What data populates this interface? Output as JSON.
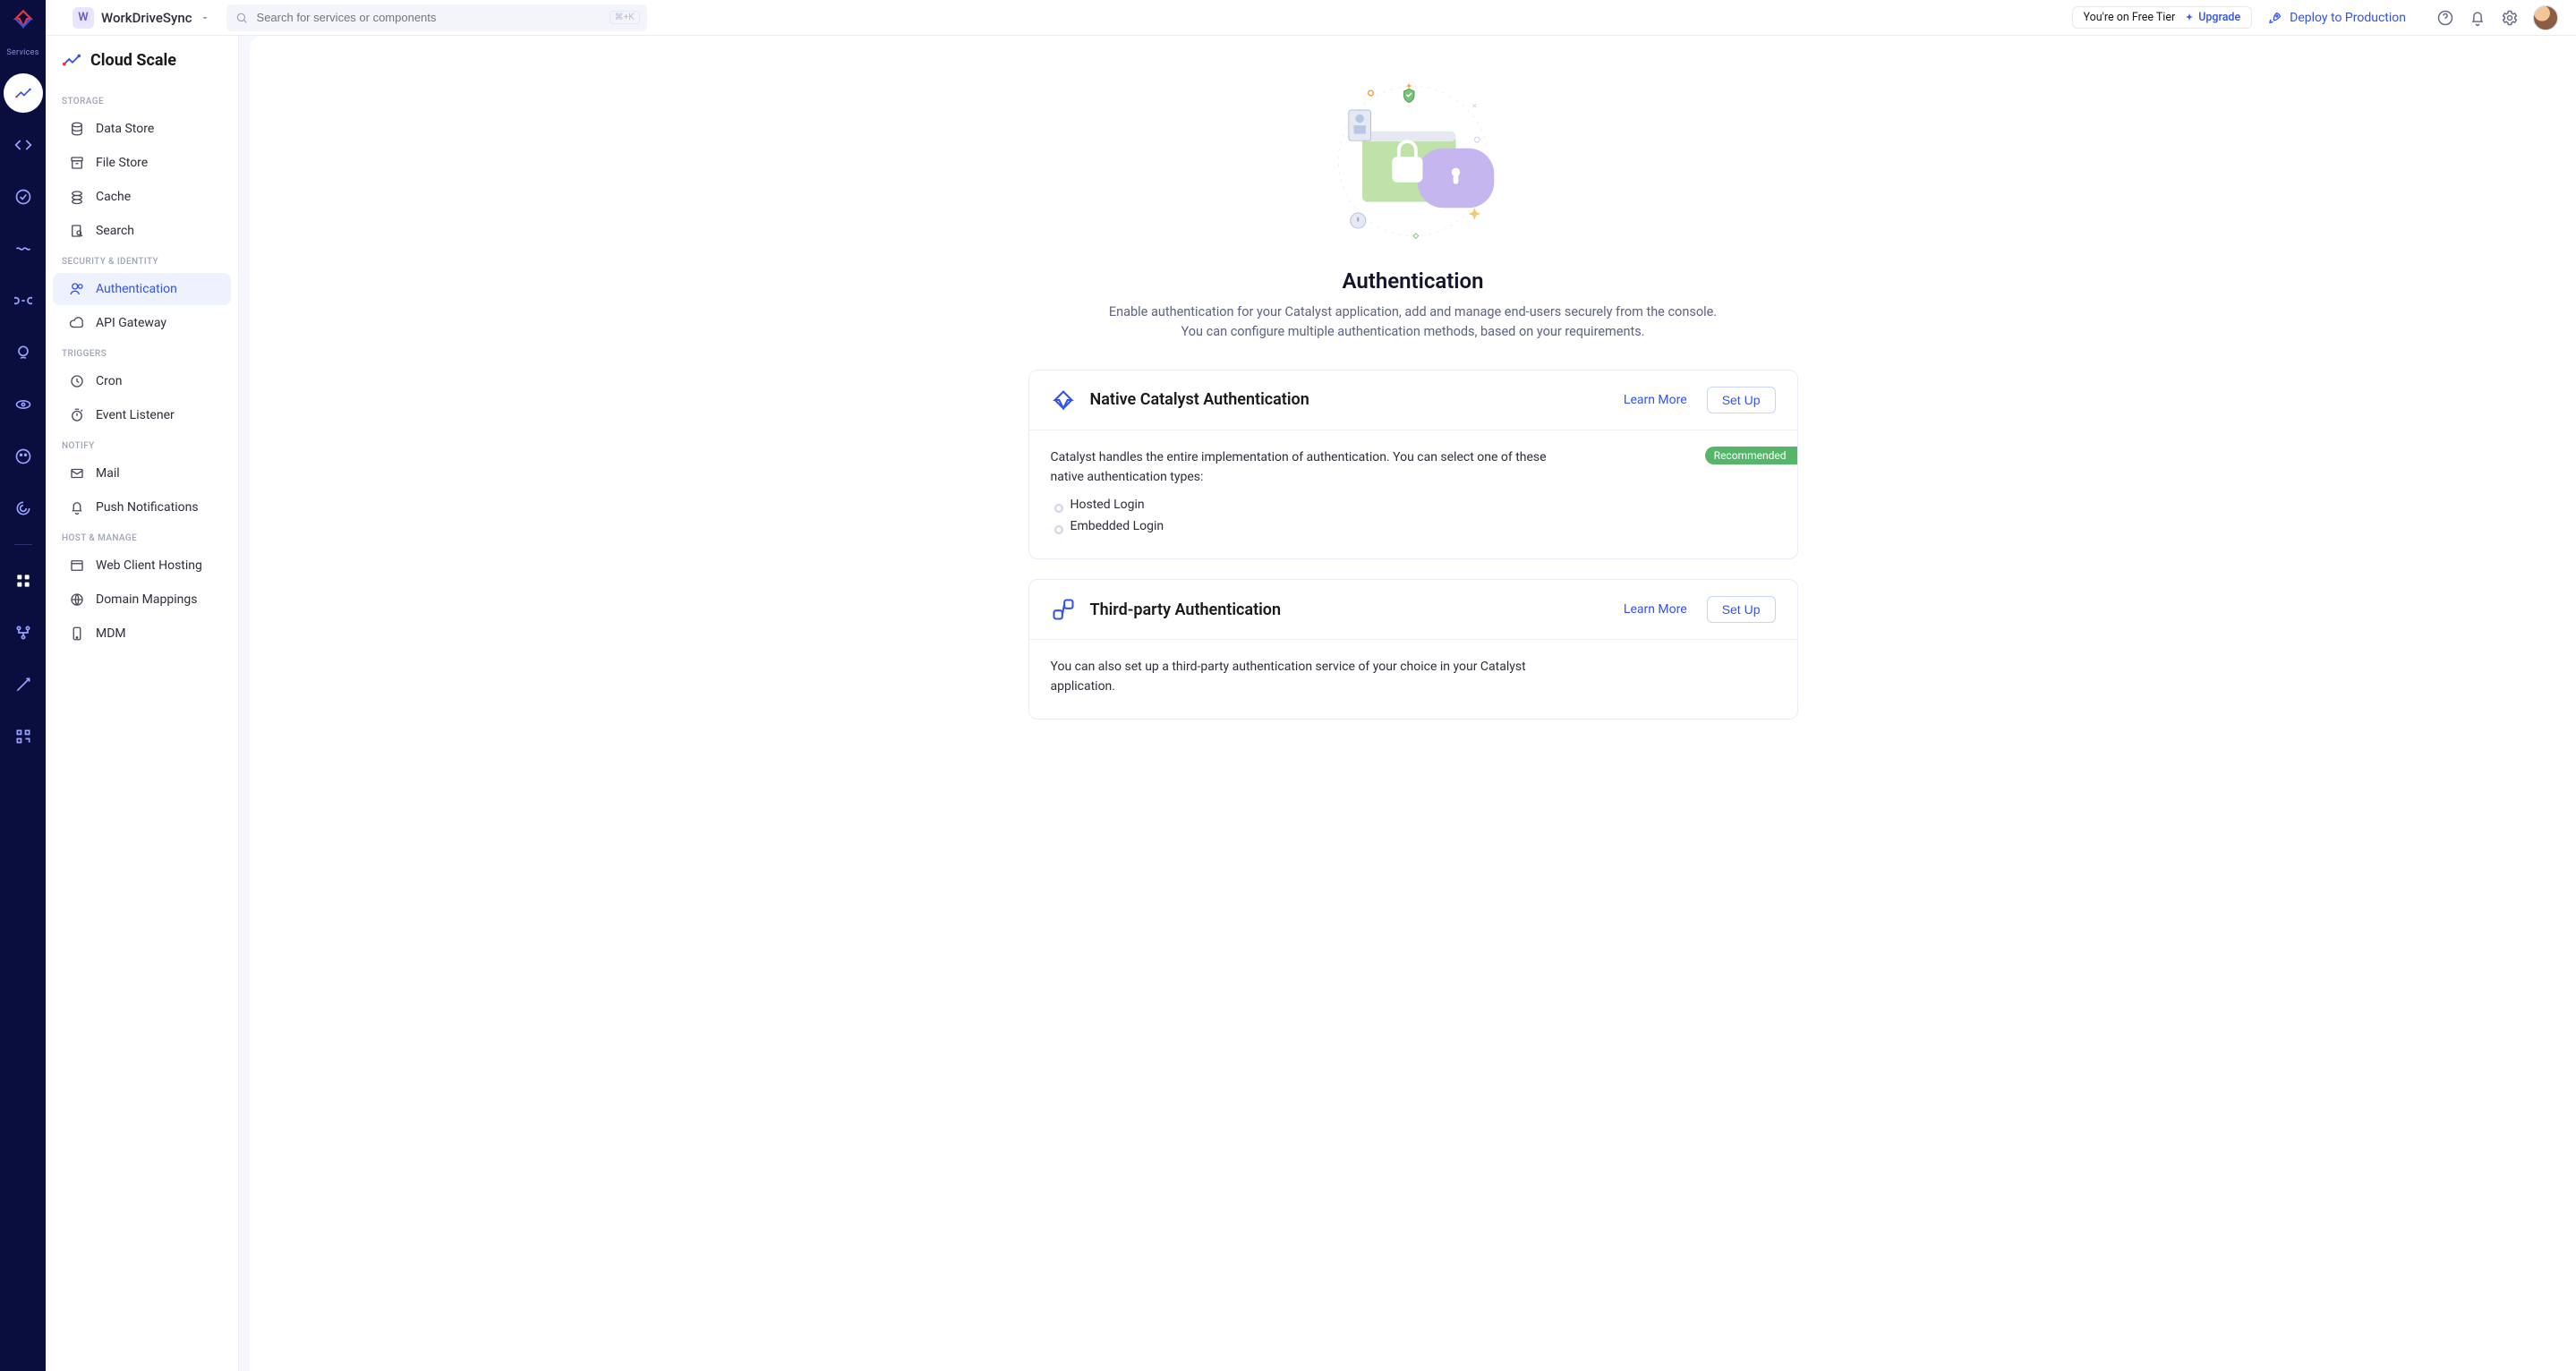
{
  "topbar": {
    "project_initial": "W",
    "project_name": "WorkDriveSync",
    "search_placeholder": "Search for services or components",
    "search_shortcut": "⌘+K",
    "tier_text": "You're on Free Tier",
    "upgrade_label": "Upgrade",
    "deploy_label": "Deploy to Production"
  },
  "rail": {
    "label": "Services"
  },
  "sidebar": {
    "brand": "Cloud Scale",
    "sections": [
      {
        "label": "STORAGE",
        "items": [
          "Data Store",
          "File Store",
          "Cache",
          "Search"
        ]
      },
      {
        "label": "SECURITY & IDENTITY",
        "items": [
          "Authentication",
          "API Gateway"
        ]
      },
      {
        "label": "TRIGGERS",
        "items": [
          "Cron",
          "Event Listener"
        ]
      },
      {
        "label": "NOTIFY",
        "items": [
          "Mail",
          "Push Notifications"
        ]
      },
      {
        "label": "HOST & MANAGE",
        "items": [
          "Web Client Hosting",
          "Domain Mappings",
          "MDM"
        ]
      }
    ]
  },
  "page": {
    "title": "Authentication",
    "desc_l1": "Enable authentication for your Catalyst application, add and manage end-users securely from the console.",
    "desc_l2": "You can configure multiple authentication methods, based on your requirements."
  },
  "card_native": {
    "title": "Native Catalyst Authentication",
    "learn": "Learn More",
    "setup": "Set Up",
    "desc": "Catalyst handles the entire implementation of authentication. You can select one of these native authentication types:",
    "opts": [
      "Hosted Login",
      "Embedded Login"
    ],
    "badge": "Recommended"
  },
  "card_tp": {
    "title": "Third-party Authentication",
    "learn": "Learn More",
    "setup": "Set Up",
    "desc": "You can also set up a third-party authentication service of your choice in your Catalyst application."
  }
}
